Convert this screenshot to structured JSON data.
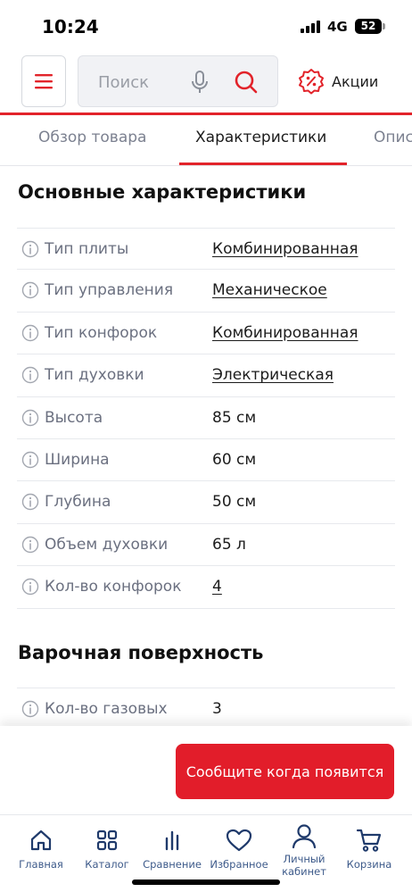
{
  "status_bar": {
    "time": "10:24",
    "network": "4G",
    "battery": "52"
  },
  "header": {
    "search_placeholder": "Поиск",
    "promo_label": "Акции",
    "icons": {
      "menu": "hamburger-menu-icon",
      "mic": "microphone-icon",
      "search": "search-icon",
      "promo": "percent-badge-icon"
    }
  },
  "colors": {
    "accent": "#e2232a",
    "nav_text": "#3d5a8a",
    "label_gray": "#6b7080"
  },
  "tabs": [
    {
      "label": "Обзор товара",
      "active": false
    },
    {
      "label": "Характеристики",
      "active": true
    },
    {
      "label": "Опис",
      "active": false
    }
  ],
  "main_specs": {
    "title": "Основные характеристики",
    "rows": [
      {
        "label": "Тип плиты",
        "value": "Комбинированная"
      },
      {
        "label": "Тип управления",
        "value": "Механическое"
      },
      {
        "label": "Тип конфорок",
        "value": "Комбинированная"
      },
      {
        "label": "Тип духовки",
        "value": "Электрическая"
      },
      {
        "label": "Высота",
        "value": "85 см"
      },
      {
        "label": "Ширина",
        "value": "60 см"
      },
      {
        "label": "Глубина",
        "value": "50 см"
      },
      {
        "label": "Объем духовки",
        "value": "65 л"
      },
      {
        "label": "Кол-во конфорок",
        "value": "4"
      }
    ]
  },
  "cooktop_specs": {
    "title": "Варочная поверхность",
    "rows": [
      {
        "label": "Кол-во газовых",
        "value": "3"
      }
    ]
  },
  "cta": {
    "label": "Сообщите когда появится"
  },
  "bottom_nav": [
    {
      "label": "Главная",
      "icon": "home-icon"
    },
    {
      "label": "Каталог",
      "icon": "catalog-grid-icon"
    },
    {
      "label": "Сравнение",
      "icon": "compare-bars-icon"
    },
    {
      "label": "Избранное",
      "icon": "heart-icon"
    },
    {
      "label": "Личный кабинет",
      "icon": "user-icon"
    },
    {
      "label": "Корзина",
      "icon": "cart-icon"
    }
  ]
}
